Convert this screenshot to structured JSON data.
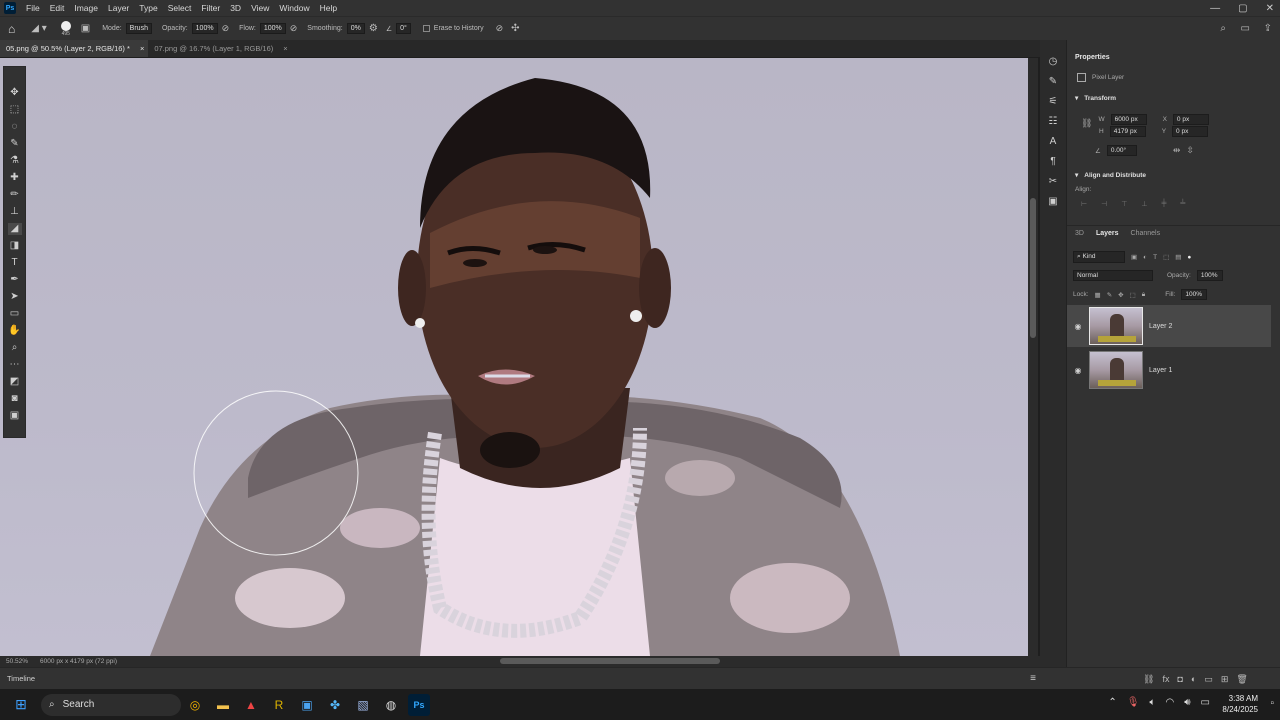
{
  "menubar": {
    "logo": "Ps",
    "items": [
      "File",
      "Edit",
      "Image",
      "Layer",
      "Type",
      "Select",
      "Filter",
      "3D",
      "View",
      "Window",
      "Help"
    ]
  },
  "window_controls": {
    "minimize": "—",
    "maximize": "▢",
    "close": "✕"
  },
  "options_bar": {
    "brush_size": "495",
    "mode_label": "Mode:",
    "mode_value": "Brush",
    "opacity_label": "Opacity:",
    "opacity_value": "100%",
    "flow_label": "Flow:",
    "flow_value": "100%",
    "smoothing_label": "Smoothing:",
    "smoothing_value": "0%",
    "angle_value": "0°",
    "erase_history_label": "Erase to History"
  },
  "tabs": [
    {
      "label": "05.png @ 50.5% (Layer 2, RGB/16) *",
      "active": true
    },
    {
      "label": "07.png @ 16.7% (Layer 1, RGB/16)",
      "active": false
    }
  ],
  "status": {
    "zoom": "50.52%",
    "doc_size": "6000 px x 4179 px (72 ppi)"
  },
  "timeline": {
    "label": "Timeline"
  },
  "properties": {
    "tab": "Properties",
    "kind": "Pixel Layer",
    "transform_title": "Transform",
    "w_label": "W",
    "w_value": "6000 px",
    "x_label": "X",
    "x_value": "0 px",
    "h_label": "H",
    "h_value": "4179 px",
    "y_label": "Y",
    "y_value": "0 px",
    "angle_value": "0.00°",
    "align_title": "Align and Distribute",
    "align_label": "Align:"
  },
  "layers_panel": {
    "tabs": [
      "3D",
      "Layers",
      "Channels"
    ],
    "active_tab": "Layers",
    "filter_kind": "Kind",
    "blend_mode": "Normal",
    "opacity_label": "Opacity:",
    "opacity_value": "100%",
    "lock_label": "Lock:",
    "fill_label": "Fill:",
    "fill_value": "100%",
    "layers": [
      {
        "name": "Layer 2",
        "selected": true,
        "visible": true
      },
      {
        "name": "Layer 1",
        "selected": false,
        "visible": true
      }
    ]
  },
  "taskbar": {
    "search_placeholder": "Search",
    "time": "3:38 AM",
    "date": "8/24/2025"
  },
  "colors": {
    "accent": "#31a8ff",
    "panel": "#323232",
    "canvas_bg": "#bdbacb"
  }
}
